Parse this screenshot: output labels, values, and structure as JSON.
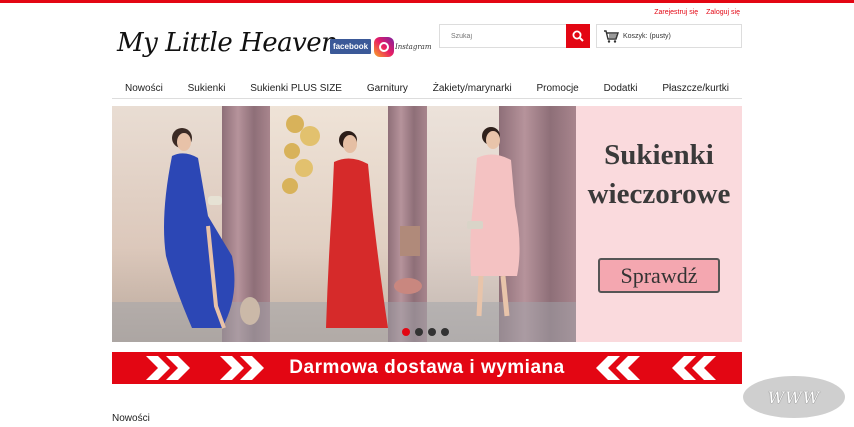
{
  "header": {
    "register_link": "Zarejestruj się",
    "login_link": "Zaloguj się",
    "logo_text": "My Little Heaven",
    "facebook_label": "facebook",
    "instagram_label": "Instagram"
  },
  "search": {
    "placeholder": "Szukaj",
    "value": ""
  },
  "cart": {
    "label": "Koszyk: (pusty)"
  },
  "nav": {
    "items": [
      {
        "label": "Nowości"
      },
      {
        "label": "Sukienki"
      },
      {
        "label": "Sukienki PLUS SIZE"
      },
      {
        "label": "Garnitury"
      },
      {
        "label": "Żakiety/marynarki"
      },
      {
        "label": "Promocje"
      },
      {
        "label": "Dodatki"
      },
      {
        "label": "Płaszcze/kurtki"
      }
    ]
  },
  "banner": {
    "title_line1": "Sukienki",
    "title_line2": "wieczorowe",
    "button_label": "Sprawdź",
    "slide_count": 4,
    "active_slide": 1,
    "colors": {
      "dress_blue": "#2c47b5",
      "dress_red": "#d62a2a",
      "dress_pink": "#f4c2c2",
      "panel_pink": "#fadadd"
    }
  },
  "strip": {
    "text": "Darmowa dostawa i wymiana"
  },
  "overlay": {
    "www_label": "WWW"
  },
  "section": {
    "title": "Nowości"
  },
  "theme": {
    "accent": "#e30613"
  }
}
